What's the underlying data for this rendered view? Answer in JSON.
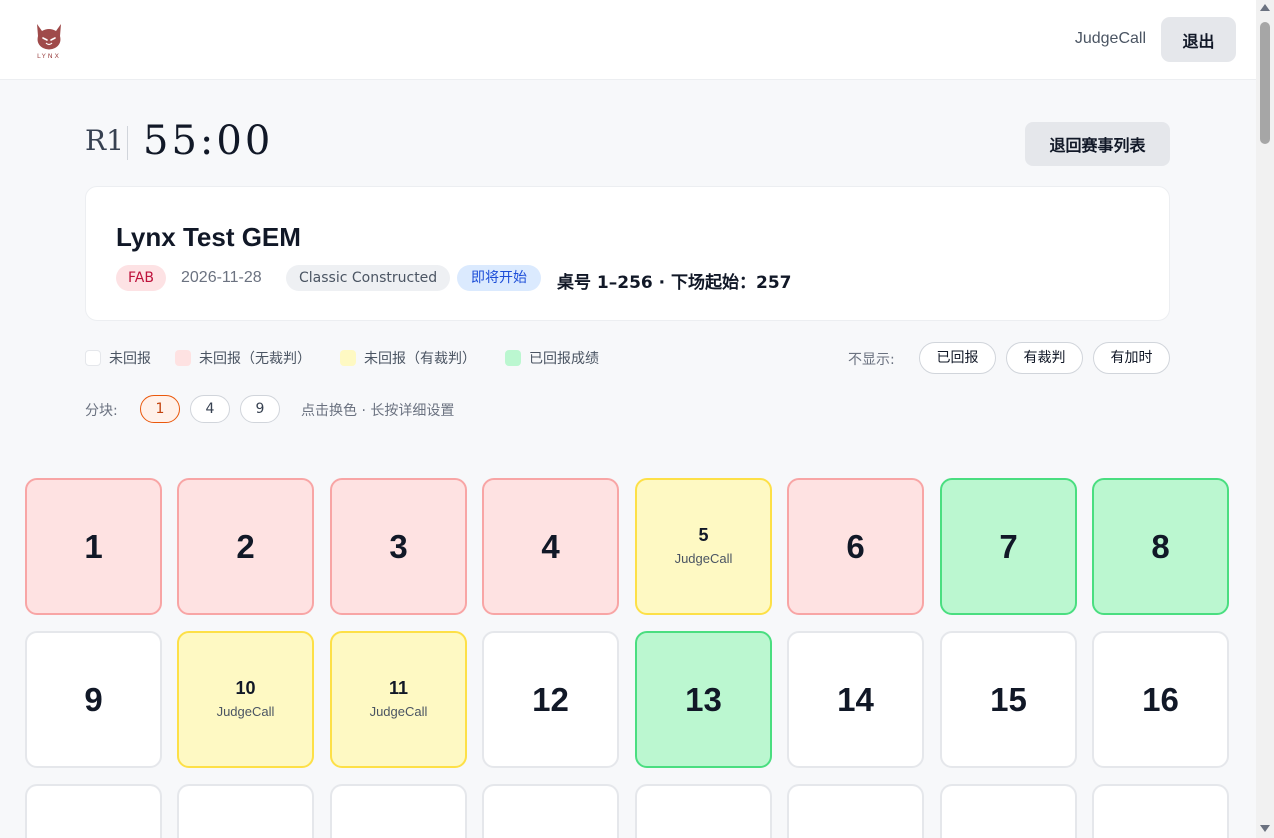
{
  "header": {
    "logo_text": "LYNX",
    "user": "JudgeCall",
    "logout_label": "退出"
  },
  "round": {
    "label": "R1",
    "timer": "55:00",
    "back_label": "退回赛事列表"
  },
  "event": {
    "title": "Lynx Test GEM",
    "game_tag": "FAB",
    "date": "2026-11-28",
    "format": "Classic Constructed",
    "status": "即将开始",
    "tables": "桌号 1–256 · 下场起始：257"
  },
  "legend": [
    {
      "label": "未回报",
      "color": "#ffffff"
    },
    {
      "label": "未回报（无裁判）",
      "color": "#fee2e2"
    },
    {
      "label": "未回报（有裁判）",
      "color": "#fef9c3"
    },
    {
      "label": "已回报成绩",
      "color": "#bbf7d0"
    }
  ],
  "filters": {
    "label": "不显示:",
    "options": [
      "已回报",
      "有裁判",
      "有加时"
    ]
  },
  "split": {
    "label": "分块:",
    "options": [
      "1",
      "4",
      "9"
    ],
    "selected": "1",
    "hint": "点击换色 · 长按详细设置"
  },
  "tables": [
    {
      "num": "1",
      "state": "pink",
      "sub": ""
    },
    {
      "num": "2",
      "state": "pink",
      "sub": ""
    },
    {
      "num": "3",
      "state": "pink",
      "sub": ""
    },
    {
      "num": "4",
      "state": "pink",
      "sub": ""
    },
    {
      "num": "5",
      "state": "yellow",
      "sub": "JudgeCall"
    },
    {
      "num": "6",
      "state": "pink",
      "sub": ""
    },
    {
      "num": "7",
      "state": "green",
      "sub": ""
    },
    {
      "num": "8",
      "state": "green",
      "sub": ""
    },
    {
      "num": "9",
      "state": "white",
      "sub": ""
    },
    {
      "num": "10",
      "state": "yellow",
      "sub": "JudgeCall"
    },
    {
      "num": "11",
      "state": "yellow",
      "sub": "JudgeCall"
    },
    {
      "num": "12",
      "state": "white",
      "sub": ""
    },
    {
      "num": "13",
      "state": "green",
      "sub": ""
    },
    {
      "num": "14",
      "state": "white",
      "sub": ""
    },
    {
      "num": "15",
      "state": "white",
      "sub": ""
    },
    {
      "num": "16",
      "state": "white",
      "sub": ""
    }
  ]
}
